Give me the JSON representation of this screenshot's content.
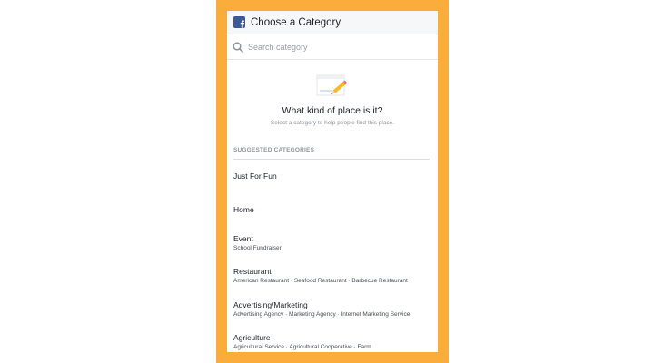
{
  "colors": {
    "frame": "#fbad3b",
    "facebook_brand": "#3b5998",
    "header_bg": "#f6f7f9"
  },
  "header": {
    "logo_icon": "facebook-logo-icon",
    "logo_glyph": "f",
    "title": "Choose a Category"
  },
  "search": {
    "icon": "search-icon",
    "placeholder": "Search category",
    "value": ""
  },
  "hero": {
    "icon": "notepad-pencil-icon",
    "title": "What kind of place is it?",
    "subtitle": "Select a category to help people find this place."
  },
  "suggested": {
    "label": "SUGGESTED CATEGORIES",
    "items": [
      {
        "name": "Just For Fun",
        "sub": ""
      },
      {
        "name": "Home",
        "sub": ""
      },
      {
        "name": "Event",
        "sub": "School Fundraiser"
      },
      {
        "name": "Restaurant",
        "sub": "American Restaurant · Seafood Restaurant · Barbecue Restaurant"
      },
      {
        "name": "Advertising/Marketing",
        "sub": "Advertising Agency · Marketing Agency · Internet Marketing Service"
      },
      {
        "name": "Agriculture",
        "sub": "Agricultural Service · Agricultural Cooperative · Farm"
      }
    ]
  }
}
